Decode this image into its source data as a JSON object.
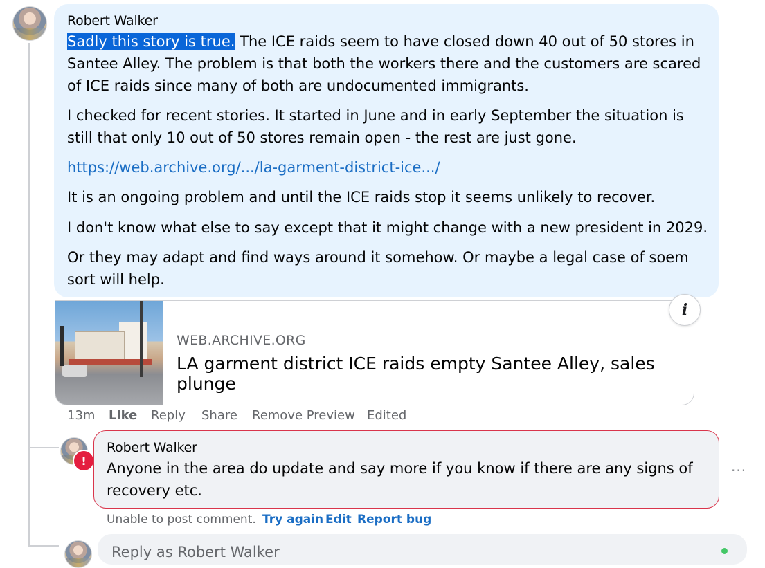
{
  "comment": {
    "author": "Robert Walker",
    "highlighted_text": "Sadly this story is true.",
    "p1_rest": " The ICE raids seem to have closed down 40 out of 50 stores in Santee Alley. The problem is that both the workers there and the customers are scared of ICE raids since many of both are undocumented immigrants.",
    "p2": "I checked for recent stories. It started in June and in early September the situation is still that only 10 out of 50 stores remain open - the rest are just gone.",
    "link": "https://web.archive.org/.../la-garment-district-ice.../",
    "p3": "It is an ongoing problem and until the ICE raids stop it seems unlikely to recover.",
    "p4": "I don't know what else to say except that it might change with a new president in 2029.",
    "p5": "Or they may adapt and find ways around it somehow. Or maybe a legal case of soem sort will help."
  },
  "preview": {
    "domain": "WEB.ARCHIVE.ORG",
    "title": "LA garment district ICE raids empty Santee Alley, sales plunge",
    "info_glyph": "i",
    "image_icon": "street-photo"
  },
  "actions": {
    "time": "13m",
    "like": "Like",
    "reply": "Reply",
    "share": "Share",
    "remove_preview": "Remove Preview",
    "edited": "Edited"
  },
  "reply": {
    "author": "Robert Walker",
    "text": "Anyone in the area do update and say more if you know if there are any signs of recovery etc.",
    "error_badge": "!",
    "more": "···"
  },
  "error_row": {
    "message": "Unable to post comment.",
    "try_again": "Try again",
    "edit": "Edit",
    "report_bug": "Report bug"
  },
  "composer": {
    "placeholder": "Reply as Robert Walker"
  },
  "colors": {
    "bubble": "#e7f3fe",
    "link": "#1a6dc4",
    "highlight": "#0a66d8",
    "error": "#d9354b"
  }
}
